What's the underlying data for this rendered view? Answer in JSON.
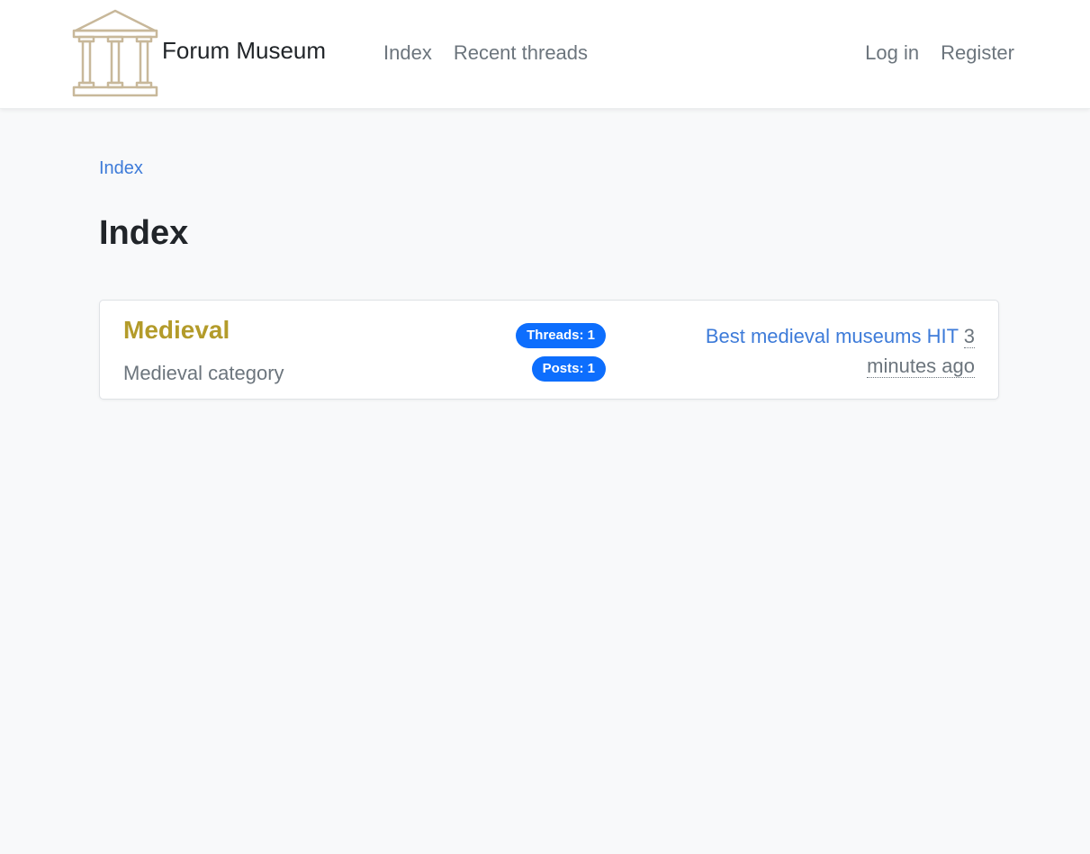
{
  "navbar": {
    "brand": "Forum Museum",
    "brand_icon": "temple-columns-icon",
    "brand_color": "#c8b89a",
    "links": [
      {
        "label": "Index"
      },
      {
        "label": "Recent threads"
      }
    ],
    "auth": [
      {
        "label": "Log in"
      },
      {
        "label": "Register"
      }
    ]
  },
  "breadcrumb": {
    "items": [
      {
        "label": "Index"
      }
    ]
  },
  "page": {
    "title": "Index"
  },
  "categories": [
    {
      "name": "Medieval",
      "description": "Medieval category",
      "threads_badge": "Threads: 1",
      "posts_badge": "Posts: 1",
      "latest_thread": "Best medieval museums HIT",
      "latest_time": "3 minutes ago"
    }
  ],
  "colors": {
    "accent": "#0d6efd",
    "link": "#3d7bd9",
    "category": "#b39b2a"
  }
}
